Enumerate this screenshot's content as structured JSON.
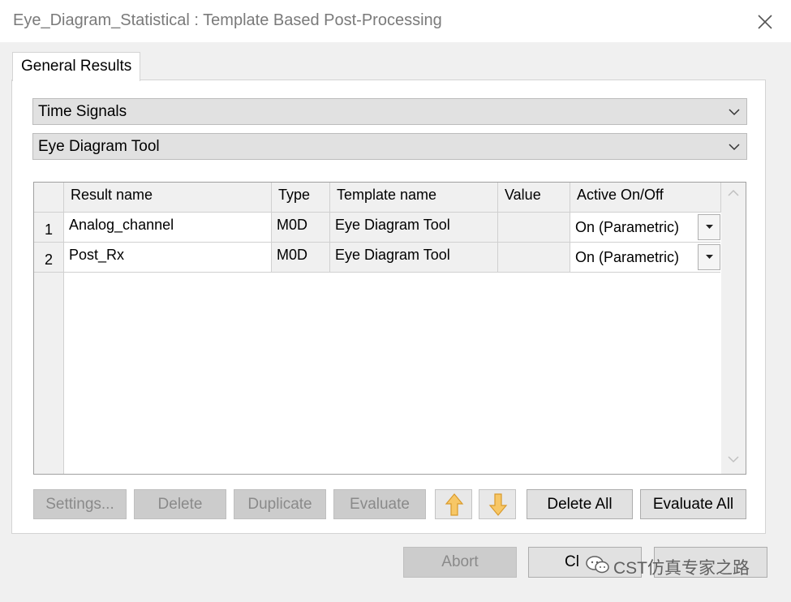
{
  "window": {
    "title": "Eye_Diagram_Statistical : Template Based Post-Processing",
    "close_icon": "close-icon"
  },
  "tabs": [
    {
      "label": "General Results",
      "active": true
    }
  ],
  "filters": {
    "category": "Time Signals",
    "tool": "Eye Diagram Tool"
  },
  "table": {
    "headers": {
      "result_name": "Result name",
      "type": "Type",
      "template_name": "Template name",
      "value": "Value",
      "active": "Active On/Off"
    },
    "rows": [
      {
        "num": "1",
        "result_name": "Analog_channel",
        "type": "M0D",
        "template_name": "Eye Diagram Tool",
        "value": "",
        "active": "On (Parametric)"
      },
      {
        "num": "2",
        "result_name": "Post_Rx",
        "type": "M0D",
        "template_name": "Eye Diagram Tool",
        "value": "",
        "active": "On (Parametric)"
      }
    ]
  },
  "buttons": {
    "settings": "Settings...",
    "delete": "Delete",
    "duplicate": "Duplicate",
    "evaluate": "Evaluate",
    "move_up_icon": "arrow-up-icon",
    "move_down_icon": "arrow-down-icon",
    "delete_all": "Delete All",
    "evaluate_all": "Evaluate All"
  },
  "footer": {
    "abort": "Abort",
    "close_partial": "Cl"
  },
  "watermark": {
    "text": "CST仿真专家之路"
  },
  "colors": {
    "arrow_fill": "#f7c766",
    "arrow_stroke": "#d99a2b",
    "disabled_text": "#8a8a8a"
  }
}
